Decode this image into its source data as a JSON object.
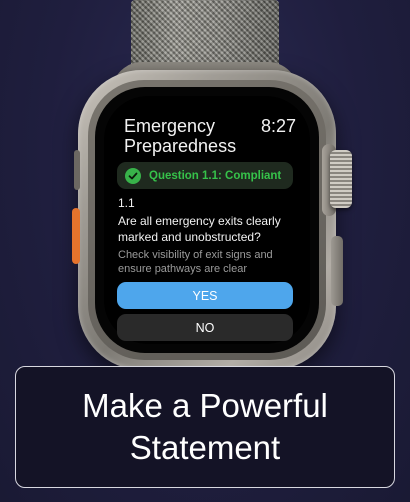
{
  "watch_screen": {
    "app_title": "Emergency Preparedness",
    "time": "8:27",
    "status_badge": {
      "label": "Question 1.1: Compliant",
      "color": "#36c24a",
      "icon": "check-circle-icon"
    },
    "question": {
      "number": "1.1",
      "text": "Are all emergency exits clearly marked and unobstructed?",
      "hint": "Check visibility of exit signs and ensure pathways are clear"
    },
    "buttons": {
      "yes_label": "YES",
      "no_label": "NO",
      "yes_color": "#4ea6ec"
    }
  },
  "caption": {
    "line1": "Make a Powerful",
    "line2": "Statement"
  }
}
